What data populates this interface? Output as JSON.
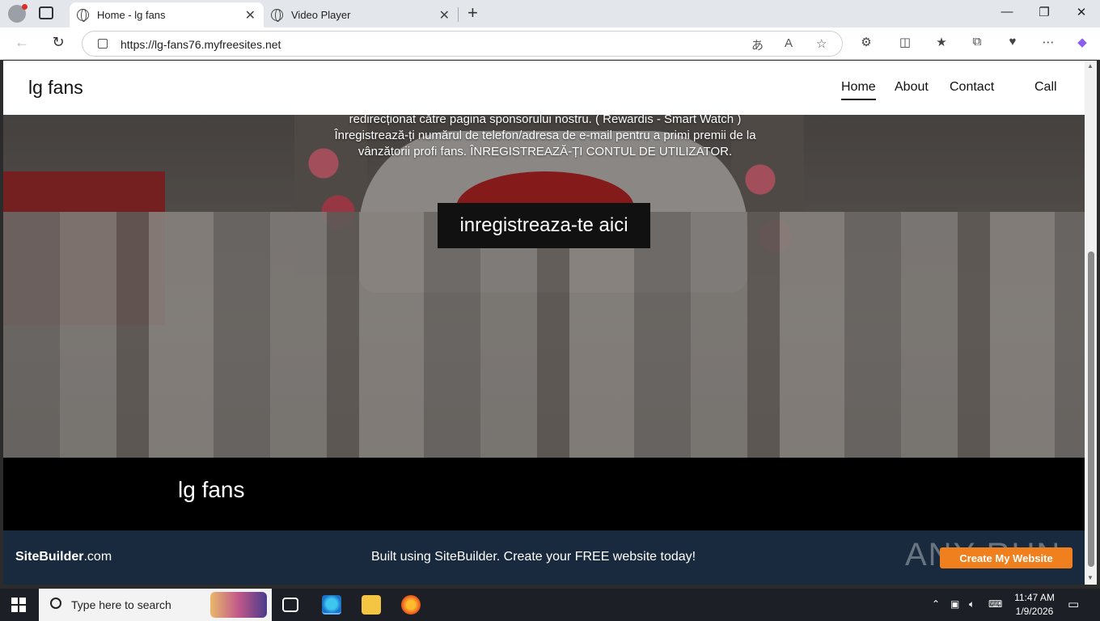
{
  "browser": {
    "tabs": [
      {
        "title": "Home - lg fans",
        "active": true
      },
      {
        "title": "Video Player",
        "active": false
      }
    ],
    "url": "https://lg-fans76.myfreesites.net"
  },
  "site": {
    "logo": "lg fans",
    "nav": [
      "Home",
      "About",
      "Contact",
      "Call"
    ],
    "hero_text": "redirecționat către pagina sponsorului nostru. ( Rewardis - Smart Watch ) Înregistrează-ți numărul de telefon/adresa de e-mail pentru a primi premii de la vânzătorii profi fans. ÎNREGISTREAZĂ-ȚI CONTUL DE UTILIZATOR.",
    "cta": "inregistreaza-te aici",
    "footer_name": "lg fans"
  },
  "sitebuilder": {
    "logo_bold": "SiteBuilder",
    "logo_thin": ".com",
    "text": "Built using SiteBuilder. Create your FREE website today!",
    "button": "Create My Website",
    "watermark": "ANY RUN"
  },
  "taskbar": {
    "search_placeholder": "Type here to search",
    "time": "11:47 AM",
    "date": "1/9/2026"
  },
  "colors": {
    "sitebuilder_bg": "#1a2a3e",
    "cta_button": "#f07f1d",
    "hero_button": "#111111"
  }
}
